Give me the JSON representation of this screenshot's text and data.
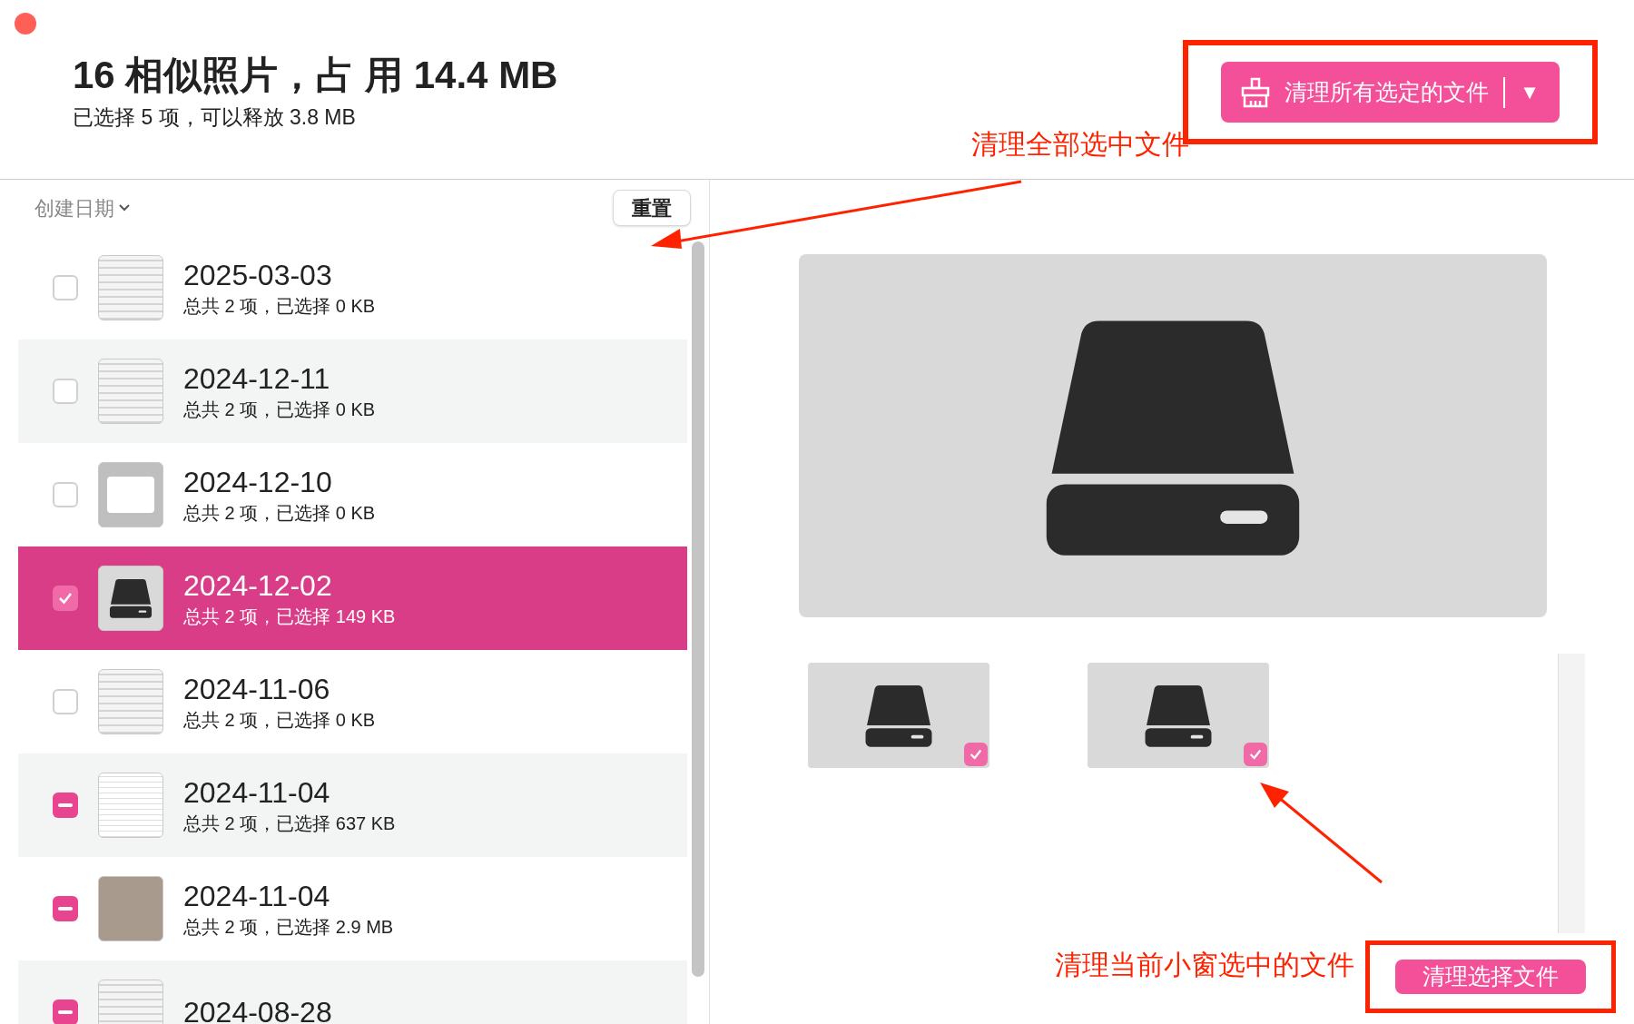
{
  "header": {
    "title": "16 相似照片，占 用 14.4 MB",
    "subtitle": "已选择 5 项，可以释放 3.8 MB",
    "clean_all_button": "清理所有选定的文件",
    "dropdown_caret": "▼"
  },
  "list": {
    "sort_label": "创建日期",
    "reset_button": "重置",
    "rows": [
      {
        "date": "2025-03-03",
        "detail": "总共 2 项，已选择 0 KB",
        "checked": false,
        "mixed": false,
        "selected": false,
        "kind": "document"
      },
      {
        "date": "2024-12-11",
        "detail": "总共 2 项，已选择 0 KB",
        "checked": false,
        "mixed": false,
        "selected": false,
        "kind": "document"
      },
      {
        "date": "2024-12-10",
        "detail": "总共 2 项，已选择 0 KB",
        "checked": false,
        "mixed": false,
        "selected": false,
        "kind": "menu"
      },
      {
        "date": "2024-12-02",
        "detail": "总共 2 项，已选择 149 KB",
        "checked": true,
        "mixed": false,
        "selected": true,
        "kind": "drive"
      },
      {
        "date": "2024-11-06",
        "detail": "总共 2 项，已选择 0 KB",
        "checked": false,
        "mixed": false,
        "selected": false,
        "kind": "document"
      },
      {
        "date": "2024-11-04",
        "detail": "总共 2 项，已选择 637 KB",
        "checked": false,
        "mixed": true,
        "selected": false,
        "kind": "spreadsheet"
      },
      {
        "date": "2024-11-04",
        "detail": "总共 2 项，已选择 2.9 MB",
        "checked": false,
        "mixed": true,
        "selected": false,
        "kind": "photo"
      },
      {
        "date": "2024-08-28",
        "checked": false,
        "mixed": true,
        "selected": false,
        "kind": "document"
      }
    ]
  },
  "preview": {
    "thumbnails": [
      {
        "checked": true
      },
      {
        "checked": true
      }
    ],
    "clean_selected_button": "清理选择文件"
  },
  "annotations": [
    {
      "text": "清理全部选中文件"
    },
    {
      "text": "清理当前小窗选中的文件"
    }
  ]
}
